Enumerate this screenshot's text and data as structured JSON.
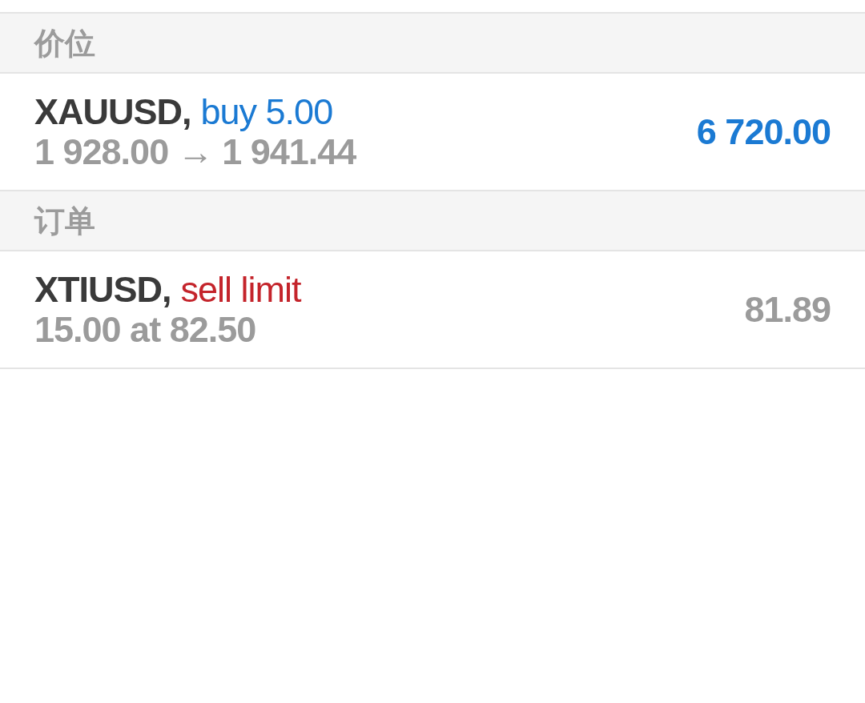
{
  "sections": [
    {
      "title": "价位",
      "kind": "positions",
      "items": [
        {
          "symbol": "XAUUSD,",
          "order": "buy 5.00",
          "color": "#1b7ad3",
          "detail": "1 928.00 → 1 941.44",
          "value": "6 720.00"
        }
      ]
    },
    {
      "title": "订单",
      "kind": "orders",
      "items": [
        {
          "symbol": "XTIUSD,",
          "order": "sell limit",
          "color": "#c4242b",
          "detail": "15.00 at 82.50",
          "value": "81.89"
        }
      ]
    }
  ]
}
